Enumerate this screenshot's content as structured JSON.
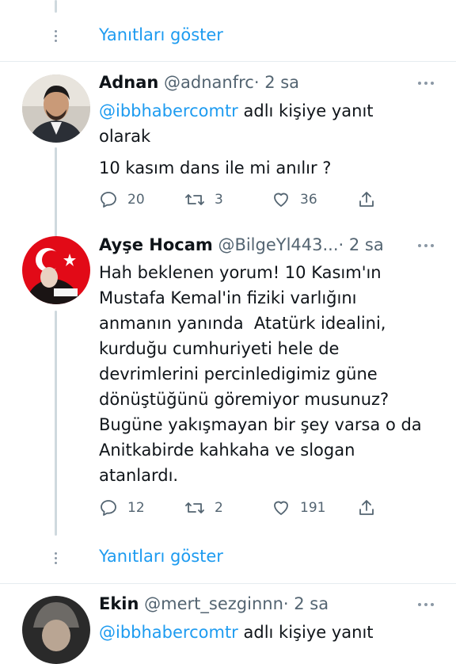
{
  "show_replies_label": "Yanıtları göster",
  "tweets": [
    {
      "name": "Adnan",
      "handle": "@adnanfrc",
      "time": "· 2 sa",
      "reply_to": {
        "mention": "@ibbhabercomtr",
        "suffix_line1": " adlı kişiye yanıt",
        "suffix_line2": "olarak"
      },
      "text": "10 kasım dans ile mi anılır ?",
      "replies": "20",
      "retweets": "3",
      "likes": "36"
    },
    {
      "name": "Ayşe Hocam",
      "handle": "@BilgeYl443...",
      "time": "· 2 sa",
      "text_lines": [
        "Hah beklenen yorum! 10 Kasım'ın",
        "Mustafa Kemal'in fiziki varlığını",
        "anmanın yanında  Atatürk idealini,",
        "kurduğu cumhuriyeti hele de",
        "devrimlerini percinledigimiz güne",
        "dönüştüğünü göremiyor musunuz?",
        "Bugüne yakışmayan bir şey varsa o da",
        "Anitkabirde kahkaha ve slogan",
        "atanlardı."
      ],
      "replies": "12",
      "retweets": "2",
      "likes": "191"
    },
    {
      "name": "Ekin",
      "handle": "@mert_sezginnn",
      "time": "· 2 sa",
      "reply_to": {
        "mention": "@ibbhabercomtr",
        "suffix_line1": " adlı kişiye yanıt"
      }
    }
  ],
  "colors": {
    "accent": "#1d9bf0",
    "text": "#0f1419",
    "secondary": "#536471",
    "divider": "#e6ecf0"
  }
}
